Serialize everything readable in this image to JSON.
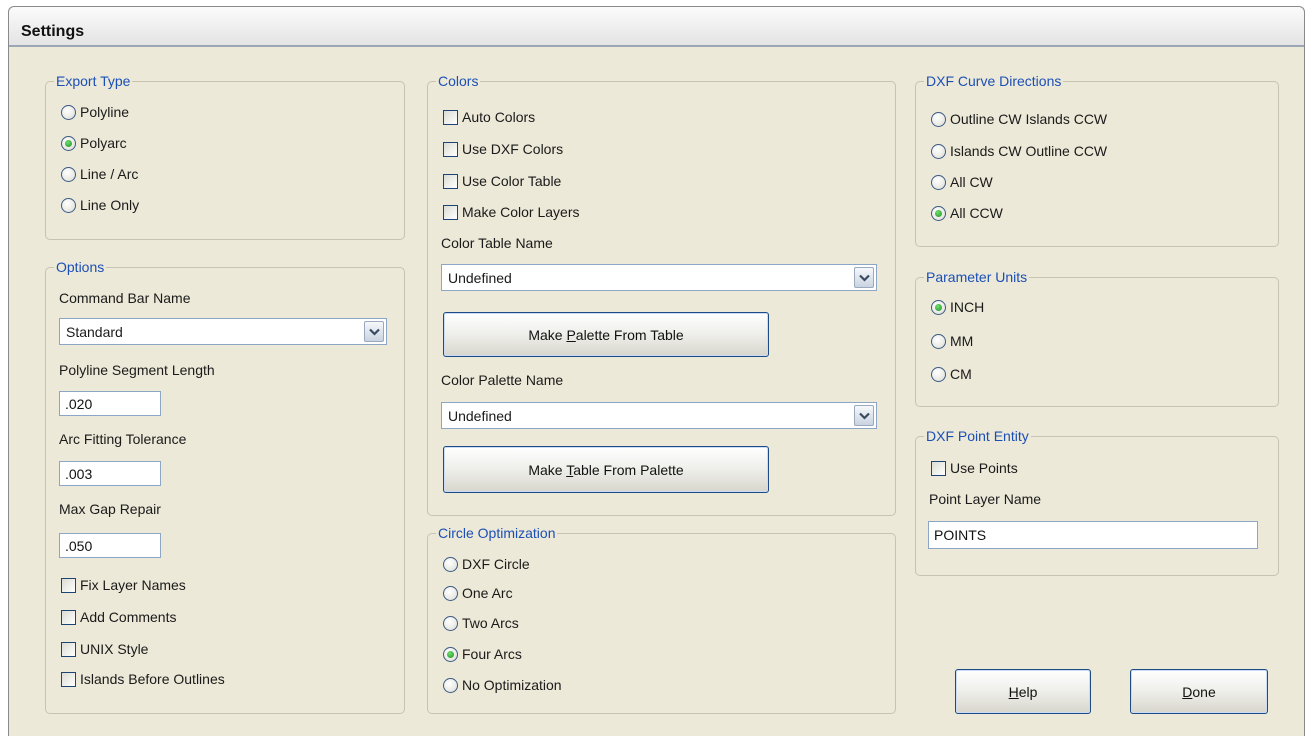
{
  "window": {
    "title": "Settings"
  },
  "export_type": {
    "legend": "Export Type",
    "options": [
      {
        "label": "Polyline",
        "checked": false
      },
      {
        "label": "Polyarc",
        "checked": true
      },
      {
        "label": "Line / Arc",
        "checked": false
      },
      {
        "label": "Line Only",
        "checked": false
      }
    ]
  },
  "options": {
    "legend": "Options",
    "command_bar_label": "Command Bar Name",
    "command_bar_value": "Standard",
    "polyline_segment_label": "Polyline Segment Length",
    "polyline_segment_value": ".020",
    "arc_tolerance_label": "Arc Fitting Tolerance",
    "arc_tolerance_value": ".003",
    "max_gap_label": "Max Gap Repair",
    "max_gap_value": ".050",
    "checkboxes": [
      {
        "label": "Fix Layer Names",
        "checked": false
      },
      {
        "label": "Add Comments",
        "checked": false
      },
      {
        "label": "UNIX Style",
        "checked": false
      },
      {
        "label": "Islands Before Outlines",
        "checked": false
      }
    ]
  },
  "colors": {
    "legend": "Colors",
    "checkboxes": [
      {
        "label": "Auto Colors",
        "checked": false
      },
      {
        "label": "Use DXF Colors",
        "checked": false
      },
      {
        "label": "Use Color Table",
        "checked": false
      },
      {
        "label": "Make Color Layers",
        "checked": false
      }
    ],
    "table_name_label": "Color Table Name",
    "table_name_value": "Undefined",
    "make_palette_button": {
      "before": "Make ",
      "mnemonic": "P",
      "after": "alette From Table"
    },
    "palette_name_label": "Color Palette Name",
    "palette_name_value": "Undefined",
    "make_table_button": {
      "before": "Make ",
      "mnemonic": "T",
      "after": "able From Palette"
    }
  },
  "circle_optimization": {
    "legend": "Circle Optimization",
    "options": [
      {
        "label": "DXF Circle",
        "checked": false
      },
      {
        "label": "One Arc",
        "checked": false
      },
      {
        "label": "Two Arcs",
        "checked": false
      },
      {
        "label": "Four Arcs",
        "checked": true
      },
      {
        "label": "No Optimization",
        "checked": false
      }
    ]
  },
  "curve_directions": {
    "legend": "DXF Curve Directions",
    "options": [
      {
        "label": "Outline CW Islands CCW",
        "checked": false
      },
      {
        "label": "Islands CW Outline CCW",
        "checked": false
      },
      {
        "label": "All CW",
        "checked": false
      },
      {
        "label": "All CCW",
        "checked": true
      }
    ]
  },
  "parameter_units": {
    "legend": "Parameter Units",
    "options": [
      {
        "label": "INCH",
        "checked": true
      },
      {
        "label": "MM",
        "checked": false
      },
      {
        "label": "CM",
        "checked": false
      }
    ]
  },
  "point_entity": {
    "legend": "DXF Point Entity",
    "use_points_label": "Use Points",
    "use_points_checked": false,
    "layer_name_label": "Point Layer Name",
    "layer_name_value": "POINTS"
  },
  "buttons": {
    "help": {
      "mnemonic": "H",
      "after": "elp"
    },
    "done": {
      "mnemonic": "D",
      "after": "one"
    }
  },
  "icons": {
    "dropdown_arrow": "chevron-down-icon"
  },
  "colors_theme": {
    "dialog_bg": "#ece9d8",
    "legend_text": "#1c4fb6",
    "radio_checked_dot": "#1e8f1e",
    "button_border": "#1e4a85"
  }
}
